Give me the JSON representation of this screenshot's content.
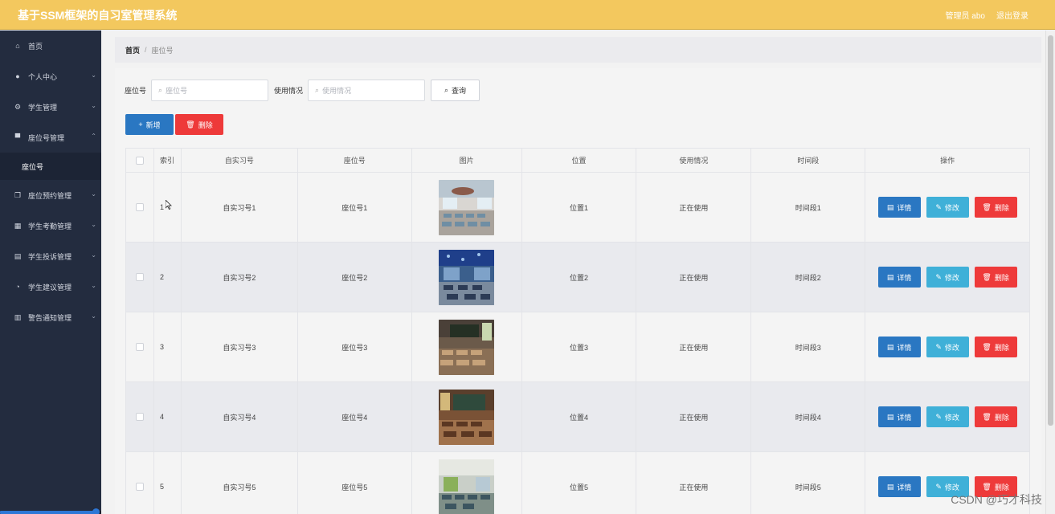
{
  "header": {
    "title": "基于SSM框架的自习室管理系统",
    "user": "管理员 abo",
    "logout": "退出登录",
    "accent": "#f3c85e"
  },
  "sidebar": {
    "items": [
      {
        "label": "首页",
        "icon": "home-icon",
        "glyph": "⌂"
      },
      {
        "label": "个人中心",
        "icon": "user-icon",
        "glyph": "●"
      },
      {
        "label": "学生管理",
        "icon": "settings-icon",
        "glyph": "⚙"
      },
      {
        "label": "座位号管理",
        "icon": "monitor-icon",
        "glyph": "▀"
      },
      {
        "label": "座位号",
        "icon": "",
        "glyph": ""
      },
      {
        "label": "座位预约管理",
        "icon": "copy-icon",
        "glyph": "❐"
      },
      {
        "label": "学生考勤管理",
        "icon": "grid-icon",
        "glyph": "▦"
      },
      {
        "label": "学生投诉管理",
        "icon": "clipboard-icon",
        "glyph": "▤"
      },
      {
        "label": "学生建议管理",
        "icon": "gauge-icon",
        "glyph": "◔"
      },
      {
        "label": "警告通知管理",
        "icon": "chart-icon",
        "glyph": "▥"
      }
    ]
  },
  "breadcrumb": {
    "home": "首页",
    "sep": "/",
    "current": "座位号"
  },
  "search": {
    "seat_label": "座位号",
    "seat_placeholder": "座位号",
    "usage_label": "使用情况",
    "usage_placeholder": "使用情况",
    "query_button": "查询"
  },
  "actions": {
    "add": "新增",
    "delete": "删除"
  },
  "table": {
    "headers": [
      "",
      "索引",
      "自实习号",
      "座位号",
      "图片",
      "位置",
      "使用情况",
      "时间段",
      "操作"
    ],
    "rows": [
      {
        "index": "1",
        "room": "自实习号1",
        "seat": "座位号1",
        "image": "classroom-photo-1",
        "position": "位置1",
        "usage": "正在使用",
        "time": "时间段1"
      },
      {
        "index": "2",
        "room": "自实习号2",
        "seat": "座位号2",
        "image": "classroom-photo-2",
        "position": "位置2",
        "usage": "正在使用",
        "time": "时间段2"
      },
      {
        "index": "3",
        "room": "自实习号3",
        "seat": "座位号3",
        "image": "classroom-photo-3",
        "position": "位置3",
        "usage": "正在使用",
        "time": "时间段3"
      },
      {
        "index": "4",
        "room": "自实习号4",
        "seat": "座位号4",
        "image": "classroom-photo-4",
        "position": "位置4",
        "usage": "正在使用",
        "time": "时间段4"
      },
      {
        "index": "5",
        "room": "自实习号5",
        "seat": "座位号5",
        "image": "classroom-photo-5",
        "position": "位置5",
        "usage": "正在使用",
        "time": "时间段5"
      }
    ],
    "op_detail": "详情",
    "op_edit": "修改",
    "op_delete": "删除"
  },
  "watermark": "CSDN @巧才科技"
}
